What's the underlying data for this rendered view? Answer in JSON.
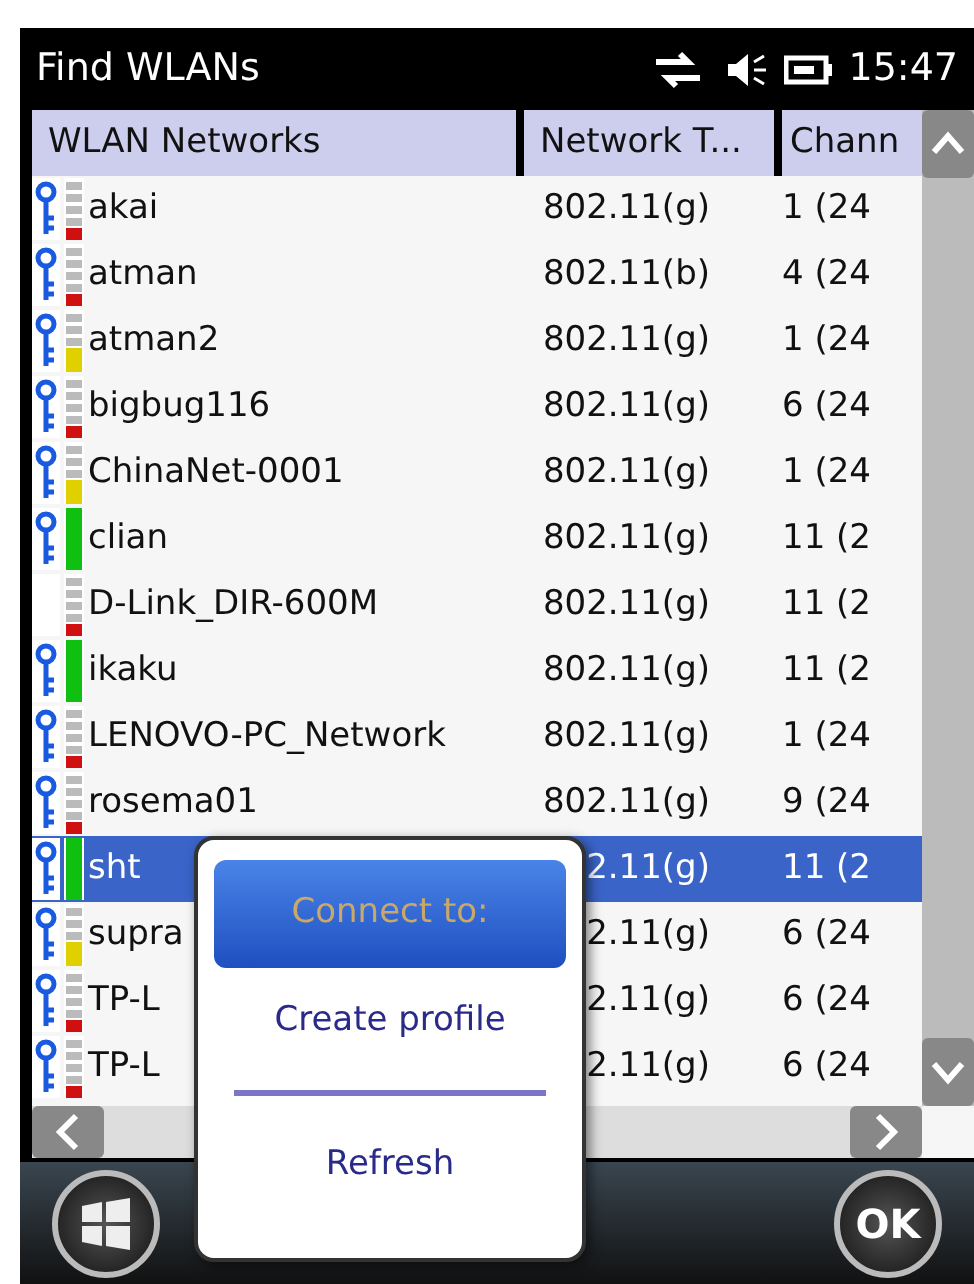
{
  "title_bar": {
    "title": "Find WLANs",
    "time": "15:47"
  },
  "table": {
    "columns": [
      "WLAN Networks",
      "Network T...",
      "Chann"
    ],
    "rows": [
      {
        "name": "akai",
        "type": "802.11(g)",
        "channel": "1 (24",
        "secured": true,
        "level": 0.2,
        "color": "#d01010",
        "selected": false
      },
      {
        "name": "atman",
        "type": "802.11(b)",
        "channel": "4 (24",
        "secured": true,
        "level": 0.2,
        "color": "#d01010",
        "selected": false
      },
      {
        "name": "atman2",
        "type": "802.11(g)",
        "channel": "1 (24",
        "secured": true,
        "level": 0.4,
        "color": "#e0d000",
        "selected": false
      },
      {
        "name": "bigbug116",
        "type": "802.11(g)",
        "channel": "6 (24",
        "secured": true,
        "level": 0.2,
        "color": "#d01010",
        "selected": false
      },
      {
        "name": "ChinaNet-0001",
        "type": "802.11(g)",
        "channel": "1 (24",
        "secured": true,
        "level": 0.4,
        "color": "#e0d000",
        "selected": false
      },
      {
        "name": "clian",
        "type": "802.11(g)",
        "channel": "11 (2",
        "secured": true,
        "level": 1,
        "color": "#10c010",
        "selected": false
      },
      {
        "name": "D-Link_DIR-600M",
        "type": "802.11(g)",
        "channel": "11 (2",
        "secured": false,
        "level": 0.2,
        "color": "#d01010",
        "selected": false
      },
      {
        "name": "ikaku",
        "type": "802.11(g)",
        "channel": "11 (2",
        "secured": true,
        "level": 1,
        "color": "#10c010",
        "selected": false
      },
      {
        "name": "LENOVO-PC_Network",
        "type": "802.11(g)",
        "channel": "1 (24",
        "secured": true,
        "level": 0.2,
        "color": "#d01010",
        "selected": false
      },
      {
        "name": "rosema01",
        "type": "802.11(g)",
        "channel": "9 (24",
        "secured": true,
        "level": 0.2,
        "color": "#d01010",
        "selected": false
      },
      {
        "name": "sht",
        "type": "2.11(g)",
        "channel": "11 (2",
        "secured": true,
        "level": 1,
        "color": "#10c010",
        "selected": true
      },
      {
        "name": "supra",
        "type": "2.11(g)",
        "channel": "6 (24",
        "secured": true,
        "level": 0.4,
        "color": "#e0d000",
        "selected": false
      },
      {
        "name": "TP-L",
        "type": "2.11(g)",
        "channel": "6 (24",
        "secured": true,
        "level": 0.2,
        "color": "#d01010",
        "selected": false
      },
      {
        "name": "TP-L",
        "type": "2.11(g)",
        "channel": "6 (24",
        "secured": true,
        "level": 0.2,
        "color": "#d01010",
        "selected": false
      }
    ]
  },
  "context_menu": {
    "items": [
      {
        "kind": "item",
        "label": "Connect to:",
        "selected": true,
        "disabled": true
      },
      {
        "kind": "item",
        "label": "Create profile",
        "selected": false,
        "disabled": false
      },
      {
        "kind": "separator"
      },
      {
        "kind": "item",
        "label": "Refresh",
        "selected": false,
        "disabled": false
      }
    ]
  },
  "soft_keys": {
    "right": "OK"
  }
}
